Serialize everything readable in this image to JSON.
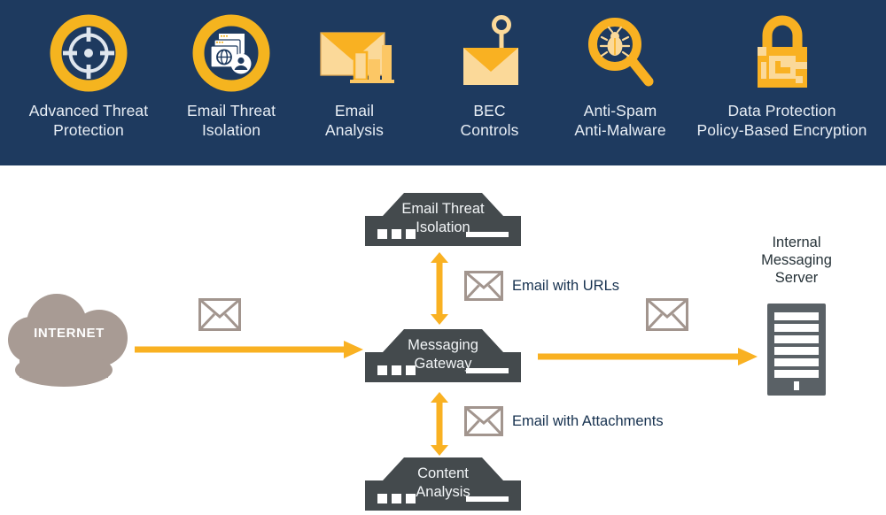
{
  "header": {
    "background_color": "#1e3a5f",
    "accent_color": "#f5b41f",
    "features": [
      {
        "icon": "crosshair-target-icon",
        "line1": "Advanced Threat",
        "line2": "Protection"
      },
      {
        "icon": "browser-windows-user-icon",
        "line1": "Email Threat",
        "line2": "Isolation"
      },
      {
        "icon": "envelope-bar-chart-icon",
        "line1": "Email",
        "line2": "Analysis"
      },
      {
        "icon": "phishing-hook-envelope-icon",
        "line1": "BEC",
        "line2": "Controls"
      },
      {
        "icon": "magnifier-bug-icon",
        "line1": "Anti-Spam",
        "line2": "Anti-Malware"
      },
      {
        "icon": "padlock-circuit-icon",
        "line1": "Data Protection",
        "line2": "Policy-Based Encryption"
      }
    ]
  },
  "diagram": {
    "cloud": {
      "label": "INTERNET",
      "color": "#a89b94"
    },
    "appliances": [
      {
        "id": "email-threat-isolation",
        "line1": "Email Threat",
        "line2": "Isolation"
      },
      {
        "id": "messaging-gateway",
        "line1": "Messaging",
        "line2": "Gateway"
      },
      {
        "id": "content-analysis",
        "line1": "Content",
        "line2": "Analysis"
      }
    ],
    "server": {
      "line1": "Internal",
      "line2": "Messaging",
      "line3": "Server"
    },
    "flows": [
      {
        "id": "email-with-urls",
        "label": "Email with URLs",
        "direction": "bidirectional"
      },
      {
        "id": "email-with-attachments",
        "label": "Email with Attachments",
        "direction": "bidirectional"
      }
    ],
    "colors": {
      "appliance": "#444a4d",
      "arrow": "#f9b122",
      "envelope_stroke": "#a2958e",
      "server": "#5a6166",
      "text_dark": "#16314f"
    }
  }
}
